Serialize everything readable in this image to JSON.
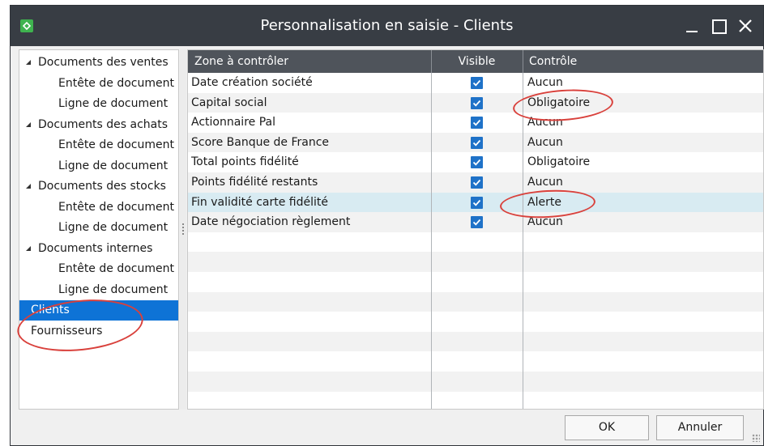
{
  "window": {
    "title": "Personnalisation en saisie - Clients"
  },
  "tree": {
    "items": [
      {
        "label": "Documents des ventes",
        "level": 0,
        "expandable": true
      },
      {
        "label": "Entête de document",
        "level": 1
      },
      {
        "label": "Ligne de document",
        "level": 1
      },
      {
        "label": "Documents des achats",
        "level": 0,
        "expandable": true
      },
      {
        "label": "Entête de document",
        "level": 1
      },
      {
        "label": "Ligne de document",
        "level": 1
      },
      {
        "label": "Documents des stocks",
        "level": 0,
        "expandable": true
      },
      {
        "label": "Entête de document",
        "level": 1
      },
      {
        "label": "Ligne de document",
        "level": 1
      },
      {
        "label": "Documents internes",
        "level": 0,
        "expandable": true
      },
      {
        "label": "Entête de document",
        "level": 1
      },
      {
        "label": "Ligne de document",
        "level": 1
      },
      {
        "label": "Clients",
        "level": 0,
        "selected": true
      },
      {
        "label": "Fournisseurs",
        "level": 0
      }
    ]
  },
  "grid": {
    "headers": {
      "zone": "Zone à contrôler",
      "visible": "Visible",
      "controle": "Contrôle"
    },
    "rows": [
      {
        "zone": "Date création société",
        "visible": true,
        "controle": "Aucun"
      },
      {
        "zone": "Capital social",
        "visible": true,
        "controle": "Obligatoire"
      },
      {
        "zone": "Actionnaire Pal",
        "visible": true,
        "controle": "Aucun"
      },
      {
        "zone": "Score Banque de France",
        "visible": true,
        "controle": "Aucun"
      },
      {
        "zone": "Total points fidélité",
        "visible": true,
        "controle": "Obligatoire"
      },
      {
        "zone": "Points fidélité restants",
        "visible": true,
        "controle": "Aucun"
      },
      {
        "zone": "Fin validité carte fidélité",
        "visible": true,
        "controle": "Alerte",
        "highlighted": true
      },
      {
        "zone": "Date négociation règlement",
        "visible": true,
        "controle": "Aucun"
      }
    ]
  },
  "buttons": {
    "ok": "OK",
    "cancel": "Annuler"
  },
  "colors": {
    "titlebar": "#383d44",
    "header": "#4f545b",
    "selection": "#0e73d6",
    "checkbox": "#1f72c8",
    "annotation": "#d9413c"
  }
}
